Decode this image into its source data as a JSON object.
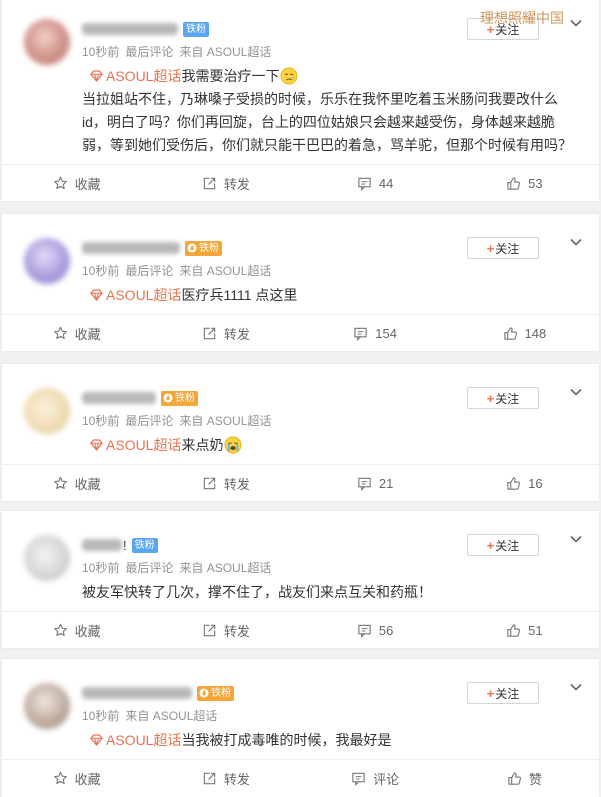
{
  "watermark": "理想照耀中国",
  "follow_button": {
    "plus": "+",
    "label": "关注"
  },
  "colors": {
    "link": "#eb7350",
    "text": "#333333",
    "meta": "#939393",
    "background": "#f1f1f1",
    "badge_blue": "#5ba6f2",
    "badge_orange": "#f5a53a"
  },
  "posts": [
    {
      "name_visible": "",
      "badge": {
        "text": "铁粉",
        "color": "#5ba6f2"
      },
      "meta": {
        "time": "10秒前",
        "note": "最后评论",
        "source": "来自 ASOUL超话"
      },
      "topic": {
        "label": "ASOUL超话",
        "text": "我需要治疗一下",
        "emoji": "crying-face"
      },
      "lines": [
        "当拉姐站不住，乃琳嗓子受损的时候，乐乐在我怀里吃着玉米肠问我要改什么",
        "id，明白了吗？你们再回旋，台上的四位姑娘只会越来越受伤，身体越来越脆",
        "弱，等到她们受伤后，你们就只能干巴巴的着急，骂羊驼，但那个时候有用吗？"
      ],
      "actions": {
        "favorite": "收藏",
        "repost": "转发",
        "comments": "44",
        "likes": "53"
      }
    },
    {
      "name_visible": "",
      "badge": {
        "text": "铁粉",
        "color": "#f5a53a"
      },
      "meta": {
        "time": "10秒前",
        "note": "最后评论",
        "source": "来自 ASOUL超话"
      },
      "topic": {
        "label": "ASOUL超话",
        "text": "医疗兵1111 点这里"
      },
      "actions": {
        "favorite": "收藏",
        "repost": "转发",
        "comments": "154",
        "likes": "148"
      }
    },
    {
      "name_visible": "",
      "badge": {
        "text": "铁粉",
        "color": "#f5a53a"
      },
      "meta": {
        "time": "10秒前",
        "note": "最后评论",
        "source": "来自 ASOUL超话"
      },
      "topic": {
        "label": "ASOUL超话",
        "text": "来点奶",
        "emoji": "loudly-crying-face"
      },
      "actions": {
        "favorite": "收藏",
        "repost": "转发",
        "comments": "21",
        "likes": "16"
      }
    },
    {
      "name_visible": "!",
      "badge": {
        "text": "铁粉",
        "color": "#5ba6f2"
      },
      "meta": {
        "time": "10秒前",
        "note": "最后评论",
        "source": "来自 ASOUL超话"
      },
      "lines": [
        "被友军快转了几次，撑不住了，战友们来点互关和药瓶！"
      ],
      "actions": {
        "favorite": "收藏",
        "repost": "转发",
        "comments": "56",
        "likes": "51"
      }
    },
    {
      "name_visible": "",
      "badge": {
        "text": "铁粉",
        "color": "#f5a53a"
      },
      "meta": {
        "time": "10秒前",
        "source": "来自 ASOUL超话"
      },
      "topic": {
        "label": "ASOUL超话",
        "text": "当我被打成毒唯的时候，我最好是"
      },
      "actions": {
        "favorite": "收藏",
        "repost": "转发",
        "comments": "评论",
        "likes": "赞"
      }
    }
  ]
}
